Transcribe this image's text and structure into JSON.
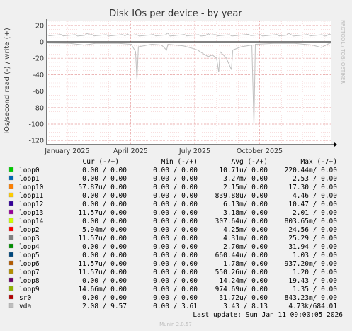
{
  "chart_data": {
    "type": "line",
    "title": "Disk IOs per device - by year",
    "ylabel": "IOs/second read (-) / write (+)",
    "side_label": "RRDTOOL / TOBI OETIKER",
    "ylim": [
      -125,
      25
    ],
    "y_ticks": [
      20,
      0,
      -20,
      -40,
      -60,
      -80,
      -100,
      -120
    ],
    "x_ticks": [
      {
        "label": "January 2025",
        "date": "2025-01-01"
      },
      {
        "label": "April 2025",
        "date": "2025-04-01"
      },
      {
        "label": "July 2025",
        "date": "2025-07-01"
      },
      {
        "label": "October 2025",
        "date": "2025-10-01"
      }
    ],
    "xlim": [
      "2024-12-03",
      "2026-01-11"
    ],
    "grid": true,
    "series": [
      {
        "name": "vda",
        "color": "#c0c0c0",
        "write_baseline": 8,
        "read_points": [
          {
            "date": "2024-12-05",
            "value": -1.5
          },
          {
            "date": "2025-01-05",
            "value": -2
          },
          {
            "date": "2025-01-25",
            "value": -4
          },
          {
            "date": "2025-02-10",
            "value": -2
          },
          {
            "date": "2025-03-15",
            "value": -2
          },
          {
            "date": "2025-04-02",
            "value": -3
          },
          {
            "date": "2025-04-08",
            "value": -12
          },
          {
            "date": "2025-04-10",
            "value": -47
          },
          {
            "date": "2025-04-12",
            "value": -6
          },
          {
            "date": "2025-05-01",
            "value": -3
          },
          {
            "date": "2025-05-15",
            "value": -4
          },
          {
            "date": "2025-05-22",
            "value": -10
          },
          {
            "date": "2025-05-24",
            "value": -3
          },
          {
            "date": "2025-06-15",
            "value": -5
          },
          {
            "date": "2025-06-28",
            "value": -8
          },
          {
            "date": "2025-07-05",
            "value": -10
          },
          {
            "date": "2025-07-12",
            "value": -14
          },
          {
            "date": "2025-07-20",
            "value": -18
          },
          {
            "date": "2025-07-26",
            "value": -16
          },
          {
            "date": "2025-08-01",
            "value": -20
          },
          {
            "date": "2025-08-04",
            "value": -37
          },
          {
            "date": "2025-08-06",
            "value": -12
          },
          {
            "date": "2025-08-15",
            "value": -20
          },
          {
            "date": "2025-08-22",
            "value": -34
          },
          {
            "date": "2025-08-24",
            "value": -10
          },
          {
            "date": "2025-09-05",
            "value": -6
          },
          {
            "date": "2025-09-20",
            "value": -4
          },
          {
            "date": "2025-09-23",
            "value": -102
          },
          {
            "date": "2025-09-25",
            "value": -3
          },
          {
            "date": "2025-10-20",
            "value": -2
          },
          {
            "date": "2025-11-20",
            "value": -2
          },
          {
            "date": "2025-12-15",
            "value": -4
          },
          {
            "date": "2025-12-28",
            "value": -7
          },
          {
            "date": "2026-01-05",
            "value": -3
          },
          {
            "date": "2026-01-11",
            "value": -1
          }
        ]
      }
    ],
    "legend": {
      "headers": {
        "cur": "Cur (-/+)",
        "min": "Min (-/+)",
        "avg": "Avg (-/+)",
        "max": "Max (-/+)"
      },
      "rows": [
        {
          "name": "loop0",
          "color": "#00cc00",
          "cur": "0.00 /  0.00",
          "min": "0.00 /  0.00",
          "avg": "10.71u/  0.00",
          "max": "220.44m/  0.00"
        },
        {
          "name": "loop1",
          "color": "#0066b3",
          "cur": "0.00 /  0.00",
          "min": "0.00 /  0.00",
          "avg": "3.27m/  0.00",
          "max": "2.53 /  0.00"
        },
        {
          "name": "loop10",
          "color": "#ff8000",
          "cur": "57.87u/  0.00",
          "min": "0.00 /  0.00",
          "avg": "2.15m/  0.00",
          "max": "17.30 /  0.00"
        },
        {
          "name": "loop11",
          "color": "#ffcc00",
          "cur": "0.00 /  0.00",
          "min": "0.00 /  0.00",
          "avg": "839.88u/  0.00",
          "max": "4.46 /  0.00"
        },
        {
          "name": "loop12",
          "color": "#330099",
          "cur": "0.00 /  0.00",
          "min": "0.00 /  0.00",
          "avg": "6.13m/  0.00",
          "max": "10.47 /  0.00"
        },
        {
          "name": "loop13",
          "color": "#990099",
          "cur": "11.57u/  0.00",
          "min": "0.00 /  0.00",
          "avg": "3.18m/  0.00",
          "max": "2.01 /  0.00"
        },
        {
          "name": "loop14",
          "color": "#ccff00",
          "cur": "0.00 /  0.00",
          "min": "0.00 /  0.00",
          "avg": "307.64u/  0.00",
          "max": "803.65m/  0.00"
        },
        {
          "name": "loop2",
          "color": "#ff0000",
          "cur": "5.94m/  0.00",
          "min": "0.00 /  0.00",
          "avg": "4.25m/  0.00",
          "max": "24.56 /  0.00"
        },
        {
          "name": "loop3",
          "color": "#808080",
          "cur": "11.57u/  0.00",
          "min": "0.00 /  0.00",
          "avg": "4.31m/  0.00",
          "max": "25.29 /  0.00"
        },
        {
          "name": "loop4",
          "color": "#008f00",
          "cur": "0.00 /  0.00",
          "min": "0.00 /  0.00",
          "avg": "2.70m/  0.00",
          "max": "31.94 /  0.00"
        },
        {
          "name": "loop5",
          "color": "#00487d",
          "cur": "0.00 /  0.00",
          "min": "0.00 /  0.00",
          "avg": "660.44u/  0.00",
          "max": "1.03 /  0.00"
        },
        {
          "name": "loop6",
          "color": "#b35a00",
          "cur": "11.57u/  0.00",
          "min": "0.00 /  0.00",
          "avg": "1.78m/  0.00",
          "max": "937.20m/  0.00"
        },
        {
          "name": "loop7",
          "color": "#b38f00",
          "cur": "11.57u/  0.00",
          "min": "0.00 /  0.00",
          "avg": "550.26u/  0.00",
          "max": "1.20 /  0.00"
        },
        {
          "name": "loop8",
          "color": "#6b006b",
          "cur": "0.00 /  0.00",
          "min": "0.00 /  0.00",
          "avg": "14.24m/  0.00",
          "max": "19.43 /  0.00"
        },
        {
          "name": "loop9",
          "color": "#8fb300",
          "cur": "14.66m/  0.00",
          "min": "0.00 /  0.00",
          "avg": "974.69u/  0.00",
          "max": "1.35 /  0.00"
        },
        {
          "name": "sr0",
          "color": "#b30000",
          "cur": "0.00 /  0.00",
          "min": "0.00 /  0.00",
          "avg": "31.72u/  0.00",
          "max": "843.23m/  0.00"
        },
        {
          "name": "vda",
          "color": "#bebebe",
          "cur": "2.08 /  9.57",
          "min": "0.00 /  3.61",
          "avg": "3.43 /  8.13",
          "max": "4.73k/684.01"
        }
      ]
    },
    "last_update": "Last update: Sun Jan 11 09:00:05 2026",
    "footer": "Munin 2.0.57"
  }
}
